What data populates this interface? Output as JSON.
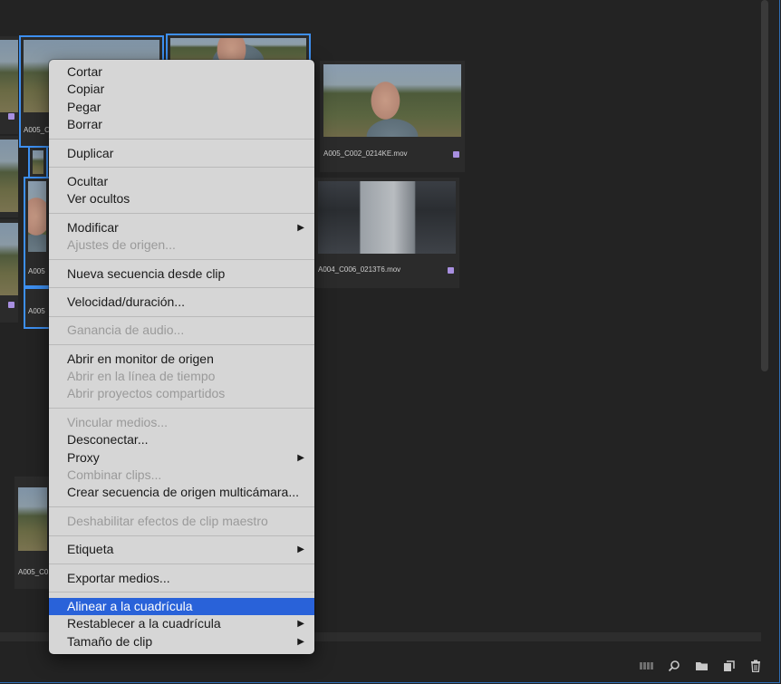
{
  "colors": {
    "selection_accent": "#3d8ff0",
    "menu_highlight": "#2962d9",
    "label_badge": "#a88fe0"
  },
  "thumbnails": [
    {
      "name": "A005_C",
      "selected": true,
      "image": "forest"
    },
    {
      "name": "",
      "selected": true,
      "image": "man"
    },
    {
      "name": "A005_C002_0214KE.mov",
      "selected": false,
      "image": "man"
    },
    {
      "name": "A004_C006_0213T6.mov",
      "selected": false,
      "image": "monitor"
    },
    {
      "name": "A005",
      "selected": true,
      "image": "forest"
    },
    {
      "name": "A005",
      "selected": true,
      "image": "forest"
    },
    {
      "name": "A005_C0",
      "selected": false,
      "image": "forest"
    }
  ],
  "context_menu": {
    "cut": "Cortar",
    "copy": "Copiar",
    "paste": "Pegar",
    "delete": "Borrar",
    "duplicate": "Duplicar",
    "hide": "Ocultar",
    "view_hidden": "Ver ocultos",
    "modify": "Modificar",
    "source_settings": "Ajustes de origen...",
    "new_sequence_from_clip": "Nueva secuencia desde clip",
    "speed_duration": "Velocidad/duración...",
    "audio_gain": "Ganancia de audio...",
    "open_in_source_monitor": "Abrir en monitor de origen",
    "open_in_timeline": "Abrir en la línea de tiempo",
    "open_shared_projects": "Abrir proyectos compartidos",
    "link_media": "Vincular medios...",
    "disconnect": "Desconectar...",
    "proxy": "Proxy",
    "merge_clips": "Combinar clips...",
    "create_multicam": "Crear secuencia de origen multicámara...",
    "disable_master_clip_effects": "Deshabilitar efectos de clip maestro",
    "label": "Etiqueta",
    "export_media": "Exportar medios...",
    "align_to_grid": "Alinear a la cuadrícula",
    "reset_to_grid": "Restablecer a la cuadrícula",
    "clip_size": "Tamaño de clip"
  },
  "toolbar_icons": [
    "freeform-view-icon",
    "search-icon",
    "new-bin-icon",
    "new-item-icon",
    "trash-icon"
  ]
}
